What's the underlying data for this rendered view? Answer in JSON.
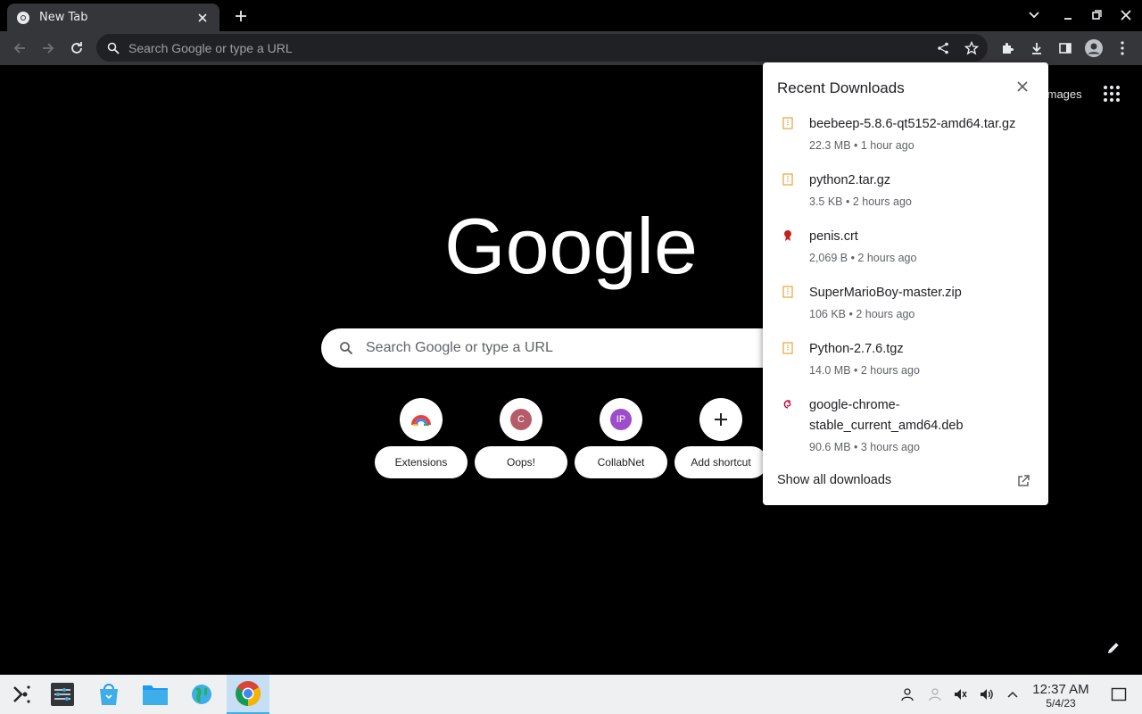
{
  "browser": {
    "tab": {
      "title": "New Tab"
    },
    "omnibox": {
      "placeholder": "Search Google or type a URL"
    }
  },
  "ntp": {
    "images_link": "Images",
    "logo_text": "Google",
    "search_placeholder": "Search Google or type a URL",
    "shortcuts": [
      {
        "label": "Extensions",
        "icon": "chrome-extensions-icon"
      },
      {
        "label": "Oops!",
        "letter": "C",
        "color": "#b55b6a"
      },
      {
        "label": "CollabNet",
        "letter": "IP",
        "color": "#9c4dcc"
      },
      {
        "label": "Add shortcut",
        "icon": "plus-icon"
      }
    ]
  },
  "downloads": {
    "title": "Recent Downloads",
    "items": [
      {
        "name": "beebeep-5.8.6-qt5152-amd64.tar.gz",
        "meta": "22.3 MB • 1 hour ago",
        "icon": "archive-icon"
      },
      {
        "name": "python2.tar.gz",
        "meta": "3.5 KB • 2 hours ago",
        "icon": "archive-icon"
      },
      {
        "name": "penis.crt",
        "meta": "2,069 B • 2 hours ago",
        "icon": "certificate-icon"
      },
      {
        "name": "SuperMarioBoy-master.zip",
        "meta": "106 KB • 2 hours ago",
        "icon": "archive-icon"
      },
      {
        "name": "Python-2.7.6.tgz",
        "meta": "14.0 MB • 2 hours ago",
        "icon": "archive-icon"
      },
      {
        "name": "google-chrome-stable_current_amd64.deb",
        "name_line1": "google-chrome-",
        "name_line2": "stable_current_amd64.deb",
        "meta": "90.6 MB • 3 hours ago",
        "icon": "debian-icon"
      }
    ],
    "show_all": "Show all downloads"
  },
  "taskbar": {
    "time": "12:37 AM",
    "date": "5/4/23"
  },
  "colors": {
    "archive": "#e8a23a",
    "certificate": "#c5221f",
    "debian": "#c70036",
    "accent": "#3daee9"
  }
}
